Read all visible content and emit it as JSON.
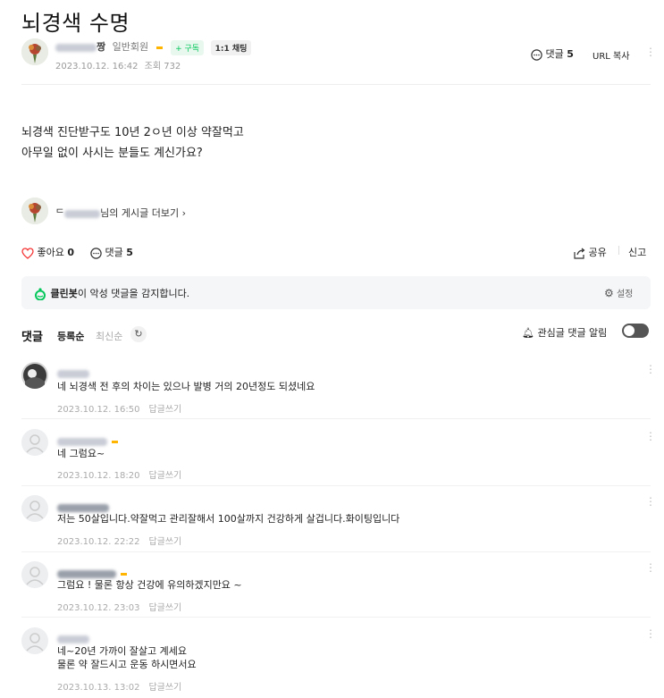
{
  "post": {
    "title": "뇌경색 수명",
    "author_suffix": "짱",
    "member_grade": "일반회원",
    "subscribe_label": "+ 구독",
    "chat_label": "1:1 채팅",
    "date": "2023.10.12. 16:42",
    "views": "조회 732",
    "comments_label": "댓글",
    "comments_count": "5",
    "url_copy_label": "URL 복사",
    "body_lines": [
      "뇌경색 진단받구도 10년 2ㅇ년 이상 약잘먹고",
      "아무일 없이 사시는 분들도  계신가요?"
    ],
    "more_posts_prefix": "ᄃ",
    "more_posts_label": "님의 게시글 더보기 ›"
  },
  "actions": {
    "like_label": "좋아요",
    "like_count": "0",
    "comment_label": "댓글",
    "comment_count": "5",
    "share_label": "공유",
    "report_label": "신고"
  },
  "cleanbot": {
    "name": "클린봇",
    "message": "이 악성 댓글을 감지합니다.",
    "settings_label": "설정",
    "accent": "#03c75a"
  },
  "comments_header": {
    "title": "댓글",
    "sort_registered": "등록순",
    "sort_latest": "최신순",
    "notify_label": "관심글 댓글 알림"
  },
  "comments": [
    {
      "name": "",
      "text": "네 뇌경색 전 후의 차이는 있으나 발병 거의 20년정도 되셨네요",
      "date": "2023.10.12. 16:50",
      "reply": "답글쓰기"
    },
    {
      "name": "",
      "text": "네 그럼요~",
      "date": "2023.10.12. 18:20",
      "reply": "답글쓰기"
    },
    {
      "name": "",
      "text": "저는 50살입니다.약잘먹고 관리잘해서 100살까지 건강하게 살겁니다.화이팅입니다",
      "date": "2023.10.12. 22:22",
      "reply": "답글쓰기"
    },
    {
      "name": "",
      "text": "그럼요 ! 물론 항상 건강에 유의하겠지만요 ~",
      "date": "2023.10.12. 23:03",
      "reply": "답글쓰기"
    },
    {
      "name": "",
      "text": "네~20년 가까이 잘살고 계세요",
      "text2": "물론 약 잘드시고 운동 하시면서요",
      "date": "2023.10.13. 13:02",
      "reply": "답글쓰기"
    }
  ]
}
